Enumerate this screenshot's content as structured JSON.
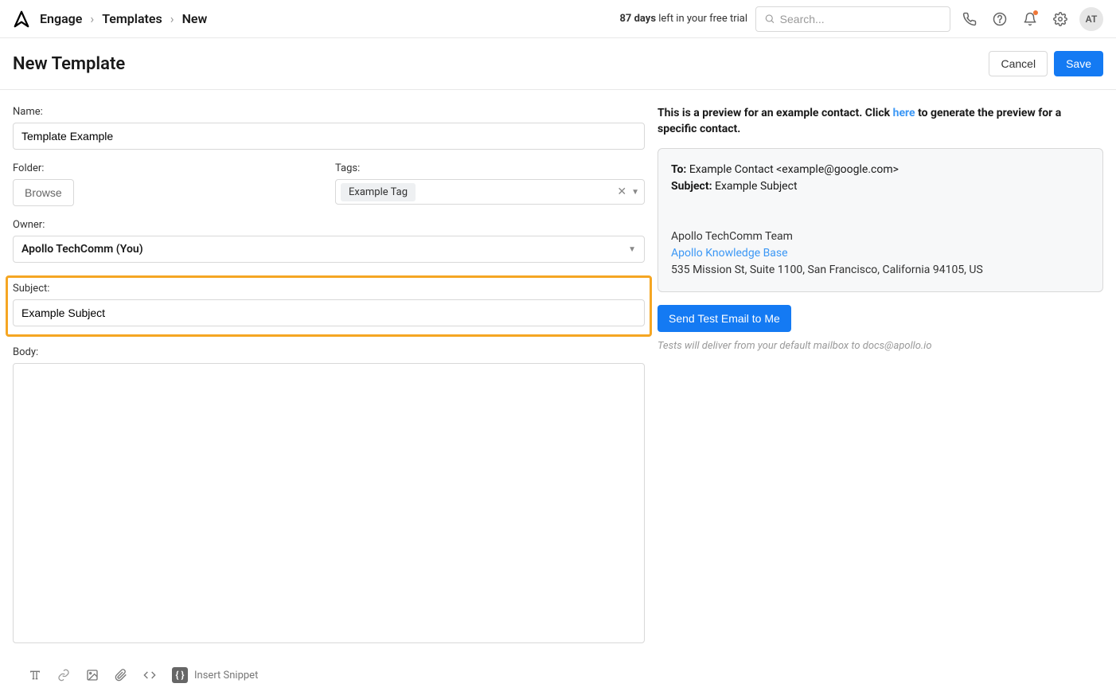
{
  "header": {
    "breadcrumb": [
      "Engage",
      "Templates",
      "New"
    ],
    "trial_days": "87 days",
    "trial_suffix": " left in your free trial",
    "search_placeholder": "Search...",
    "avatar_initials": "AT"
  },
  "page": {
    "title": "New Template",
    "cancel_label": "Cancel",
    "save_label": "Save"
  },
  "form": {
    "name_label": "Name:",
    "name_value": "Template Example",
    "folder_label": "Folder:",
    "browse_label": "Browse",
    "tags_label": "Tags:",
    "tag_chip": "Example Tag",
    "owner_label": "Owner:",
    "owner_value": "Apollo TechComm (You)",
    "subject_label": "Subject:",
    "subject_value": "Example Subject",
    "body_label": "Body:"
  },
  "toolbar": {
    "insert_snippet": "Insert Snippet"
  },
  "preview": {
    "intro_prefix": "This is a preview for an example contact. Click ",
    "here_link": "here",
    "intro_suffix": " to generate the preview for a specific contact.",
    "to_label": "To:",
    "to_value": " Example Contact <example@google.com>",
    "subject_label": "Subject:",
    "subject_value": " Example Subject",
    "team_line": "Apollo TechComm Team",
    "kb_link": "Apollo Knowledge Base",
    "address": "535 Mission St, Suite 1100, San Francisco, California 94105, US",
    "send_test_label": "Send Test Email to Me",
    "test_note": "Tests will deliver from your default mailbox to docs@apollo.io"
  }
}
